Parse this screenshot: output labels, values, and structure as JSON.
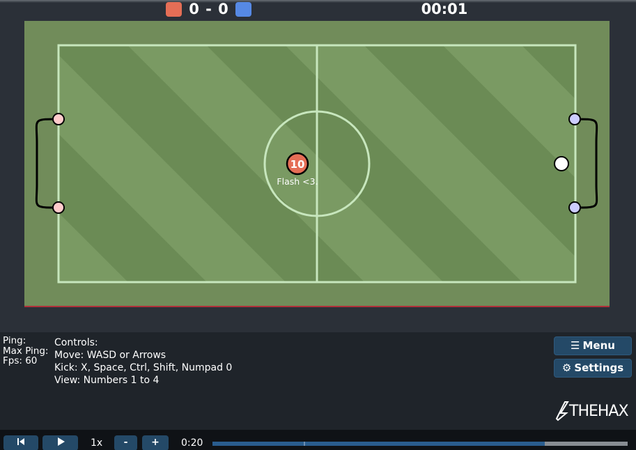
{
  "scoreboard": {
    "score": "0 - 0",
    "timer": "00:01",
    "red_color": "#e56e56",
    "blue_color": "#5689e5"
  },
  "field": {
    "player": {
      "number": "10",
      "name": "Flash <3.",
      "team": "red"
    },
    "ball_color": "#ffffff",
    "red_post_color": "#ffcccc",
    "blue_post_color": "#ccccff",
    "grass_color": "#718c5a"
  },
  "stats": {
    "ping_label": "Ping:",
    "max_ping_label": "Max Ping:",
    "fps_label": "Fps: 60"
  },
  "controls": {
    "title": "Controls:",
    "move": "Move: WASD or Arrows",
    "kick": "Kick: X, Space, Ctrl, Shift, Numpad 0",
    "view": "View: Numbers 1 to 4"
  },
  "menu": {
    "menu_label": "Menu",
    "menu_icon": "hamburger-icon",
    "settings_label": "Settings",
    "settings_icon": "gear-icon",
    "logo_text": "THEHAX"
  },
  "replay": {
    "speed": "1x",
    "minus_label": "-",
    "plus_label": "+",
    "time": "0:20",
    "progress": 0.8,
    "marker": 0.22
  }
}
